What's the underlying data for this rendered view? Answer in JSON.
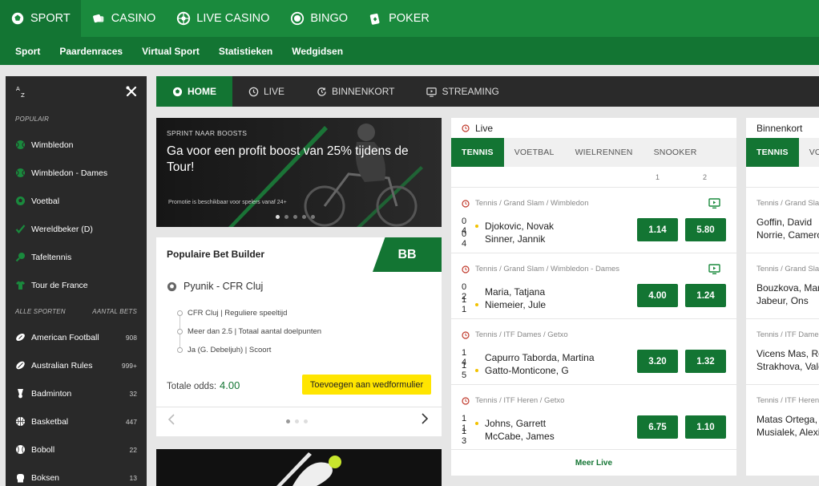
{
  "topnav": {
    "items": [
      {
        "label": "SPORT",
        "icon": "soccer-ball-icon",
        "active": true
      },
      {
        "label": "CASINO",
        "icon": "dice-icon"
      },
      {
        "label": "LIVE CASINO",
        "icon": "roulette-icon"
      },
      {
        "label": "BINGO",
        "icon": "bingo-ball-icon"
      },
      {
        "label": "POKER",
        "icon": "cards-icon"
      }
    ]
  },
  "subnav": {
    "items": [
      "Sport",
      "Paardenraces",
      "Virtual Sport",
      "Statistieken",
      "Wedgidsen"
    ]
  },
  "sidebar": {
    "sort_label": "A↓Z",
    "popular_heading": "POPULAIR",
    "popular": [
      {
        "label": "Wimbledon",
        "icon": "tennis-ball-icon"
      },
      {
        "label": "Wimbledon - Dames",
        "icon": "tennis-ball-icon"
      },
      {
        "label": "Voetbal",
        "icon": "soccer-ball-icon"
      },
      {
        "label": "Wereldbeker (D)",
        "icon": "check-icon"
      },
      {
        "label": "Tafeltennis",
        "icon": "table-tennis-icon"
      },
      {
        "label": "Tour de France",
        "icon": "jersey-icon"
      }
    ],
    "all_heading": "ALLE SPORTEN",
    "count_heading": "AANTAL BETS",
    "all": [
      {
        "label": "American Football",
        "count": "908",
        "icon": "american-football-icon"
      },
      {
        "label": "Australian Rules",
        "count": "999+",
        "icon": "rugby-ball-icon"
      },
      {
        "label": "Badminton",
        "count": "32",
        "icon": "shuttlecock-icon"
      },
      {
        "label": "Basketbal",
        "count": "447",
        "icon": "basketball-icon"
      },
      {
        "label": "Boboll",
        "count": "22",
        "icon": "baseball-icon"
      },
      {
        "label": "Boksen",
        "count": "13",
        "icon": "boxing-glove-icon"
      }
    ]
  },
  "maintabs": [
    {
      "label": "HOME",
      "icon": "soccer-ball-icon",
      "active": true
    },
    {
      "label": "LIVE",
      "icon": "clock-icon"
    },
    {
      "label": "BINNENKORT",
      "icon": "refresh-clock-icon"
    },
    {
      "label": "STREAMING",
      "icon": "tv-icon"
    }
  ],
  "promo": {
    "kicker": "SPRINT NAAR BOOSTS",
    "title": "Ga voor een profit boost van 25% tijdens de Tour!",
    "small": "Promotie is beschikbaar voor spelers vanaf 24+"
  },
  "betbuilder": {
    "title": "Populaire Bet Builder",
    "badge": "BB",
    "match": "Pyunik - CFR Cluj",
    "legs": [
      "CFR Cluj | Reguliere speeltijd",
      "Meer dan 2.5 | Totaal aantal doelpunten",
      "Ja (G. Debeljuh) | Scoort"
    ],
    "odds_label": "Totale odds:",
    "odds_value": "4.00",
    "add_button": "Toevoegen aan wedformulier"
  },
  "live": {
    "title": "Live",
    "tabs": [
      "TENNIS",
      "VOETBAL",
      "WIELRENNEN",
      "SNOOKER"
    ],
    "col1": "1",
    "col2": "2",
    "events": [
      {
        "comp": "Tennis / Grand Slam / Wimbledon",
        "tv": true,
        "p1": {
          "score": "0 4",
          "name": "Djokovic, Novak",
          "serve": true
        },
        "p2": {
          "score": "0 4",
          "name": "Sinner, Jannik",
          "serve": false
        },
        "o1": "1.14",
        "o2": "5.80"
      },
      {
        "comp": "Tennis / Grand Slam / Wimbledon - Dames",
        "tv": true,
        "p1": {
          "score": "0 2",
          "name": "Maria, Tatjana",
          "serve": false
        },
        "p2": {
          "score": "1 1",
          "name": "Niemeier, Jule",
          "serve": true
        },
        "o1": "4.00",
        "o2": "1.24"
      },
      {
        "comp": "Tennis / ITF Dames / Getxo",
        "tv": false,
        "p1": {
          "score": "1 4",
          "name": "Capurro Taborda, Martina",
          "serve": false
        },
        "p2": {
          "score": "1 5",
          "name": "Gatto-Monticone, G",
          "serve": true
        },
        "o1": "3.20",
        "o2": "1.32"
      },
      {
        "comp": "Tennis / ITF Heren / Getxo",
        "tv": false,
        "p1": {
          "score": "1 1",
          "name": "Johns, Garrett",
          "serve": true
        },
        "p2": {
          "score": "1 3",
          "name": "McCabe, James",
          "serve": false
        },
        "o1": "6.75",
        "o2": "1.10"
      }
    ],
    "more": "Meer Live"
  },
  "soon": {
    "title": "Binnenkort",
    "tabs": [
      "TENNIS",
      "VOETBAL"
    ],
    "events": [
      {
        "comp": "Tennis / Grand Slam / Wimbledon",
        "p1": "Goffin, David",
        "p2": "Norrie, Cameron"
      },
      {
        "comp": "Tennis / Grand Slam / Wimbledon - Dames",
        "p1": "Bouzkova, Marie",
        "p2": "Jabeur, Ons"
      },
      {
        "comp": "Tennis / ITF Dames / Getxo",
        "p1": "Vicens Mas, Rosa",
        "p2": "Strakhova, Valeriya"
      },
      {
        "comp": "Tennis / ITF Heren / Getxo",
        "p1": "Matas Ortega, Xavier",
        "p2": "Musialek, Alexis"
      }
    ]
  },
  "colors": {
    "brand": "#1a8a3d",
    "brand_dark": "#137533",
    "cta": "#ffe500",
    "sidebar": "#292929"
  }
}
